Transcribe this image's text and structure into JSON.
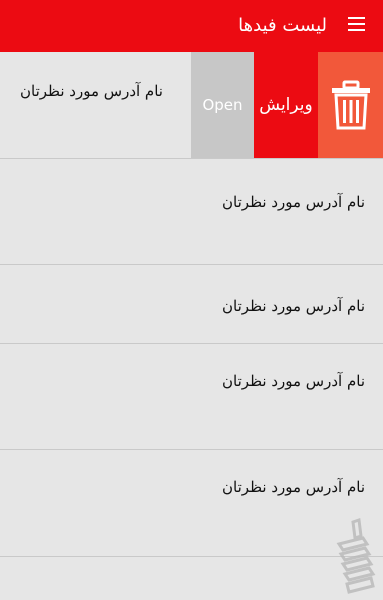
{
  "appbar": {
    "title": "لیست فیدها",
    "menu_icon": "hamburger-menu-icon",
    "background": "#ec0b12"
  },
  "list": {
    "swiped_row": {
      "label": "نام آدرس مورد نظرتان",
      "actions": {
        "open_label": "Open",
        "edit_label": "ویرایش",
        "delete_icon": "trash-icon"
      }
    },
    "rows": [
      {
        "label": "نام آدرس مورد نظرتان"
      },
      {
        "label": "نام آدرس مورد نظرتان"
      },
      {
        "label": "نام آدرس مورد نظرتان"
      },
      {
        "label": "نام آدرس مورد نظرتان"
      }
    ]
  },
  "colors": {
    "accent_red": "#ec0b12",
    "delete_orange": "#f2583a",
    "open_gray": "#c7c7c7",
    "list_bg": "#e6e6e6"
  }
}
